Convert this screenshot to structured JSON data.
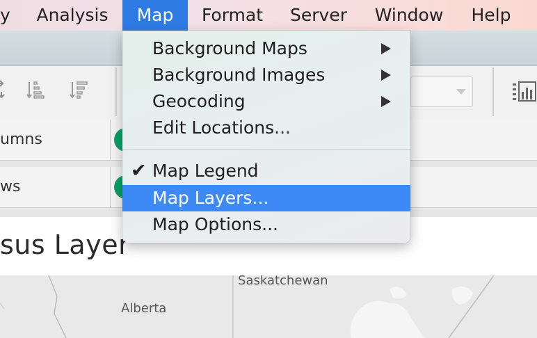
{
  "menubar": {
    "items": [
      "y",
      "Analysis",
      "Map",
      "Format",
      "Server",
      "Window",
      "Help"
    ],
    "active": "Map"
  },
  "shelves": {
    "columns_label": "umns",
    "rows_label": "ws"
  },
  "sheet": {
    "title": "sus Layer"
  },
  "map": {
    "labels": [
      "Saskatchewan",
      "Alberta"
    ]
  },
  "map_menu": {
    "items": [
      {
        "label": "Background Maps",
        "submenu": true
      },
      {
        "label": "Background Images",
        "submenu": true
      },
      {
        "label": "Geocoding",
        "submenu": true
      },
      {
        "label": "Edit Locations..."
      },
      {
        "label": "Map Legend",
        "checked": true
      },
      {
        "label": "Map Layers...",
        "highlighted": true
      },
      {
        "label": "Map Options..."
      }
    ]
  },
  "colors": {
    "menubar_active": "#2e7be4",
    "menu_highlight": "#3d8af6",
    "pill_green": "#0aa067"
  }
}
